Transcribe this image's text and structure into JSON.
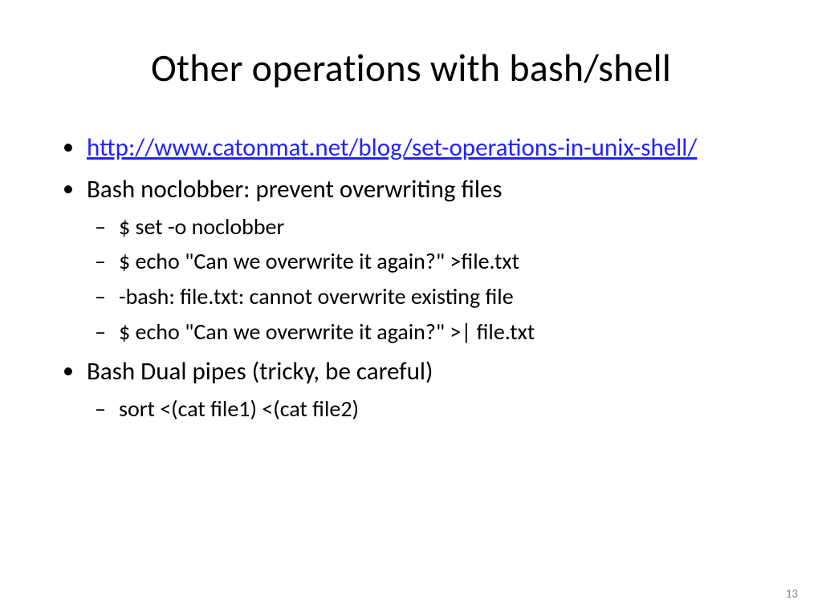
{
  "title": "Other operations with bash/shell",
  "bullets": {
    "link_text": "http://www.catonmat.net/blog/set-operations-in-unix-shell/",
    "noclobber_heading": "Bash noclobber: prevent overwriting files",
    "noclobber_sub": [
      "$ set -o noclobber",
      "$ echo \"Can we overwrite it again?\" >file.txt",
      "-bash: file.txt: cannot overwrite existing file",
      "$ echo \"Can we overwrite it again?\" >| file.txt"
    ],
    "dualpipes_heading": "Bash Dual pipes (tricky, be careful)",
    "dualpipes_sub": [
      "sort <(cat file1) <(cat file2)"
    ]
  },
  "page_number": "13"
}
